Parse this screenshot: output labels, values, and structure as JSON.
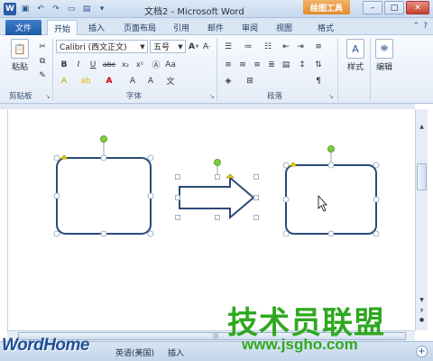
{
  "titlebar": {
    "title": "文档2 - Microsoft Word",
    "context_tab": "绘图工具",
    "app_icon": "W",
    "quick_access": [
      "save-icon",
      "undo-icon",
      "redo-icon",
      "new-icon",
      "open-icon",
      "customize-icon"
    ]
  },
  "tabs": [
    {
      "label": "文件"
    },
    {
      "label": "开始"
    },
    {
      "label": "插入"
    },
    {
      "label": "页面布局"
    },
    {
      "label": "引用"
    },
    {
      "label": "邮件"
    },
    {
      "label": "审阅"
    },
    {
      "label": "视图"
    },
    {
      "label": "格式"
    }
  ],
  "ribbon": {
    "clipboard": {
      "paste_label": "粘贴",
      "group_label": "剪贴板"
    },
    "font": {
      "font_name": "Calibri (西文正文)",
      "font_size": "五号",
      "group_label": "字体"
    },
    "paragraph": {
      "group_label": "段落"
    },
    "styles": {
      "label": "样式"
    },
    "editing": {
      "label": "编辑"
    }
  },
  "statusbar": {
    "language": "英语(美国)",
    "mode": "插入",
    "zoom_plus": "+"
  },
  "watermark": {
    "left_logo": "WordHome",
    "brand_cn": "技术员联盟",
    "url": "www.jsgho.com"
  },
  "colors": {
    "shape_stroke": "#2c4a78",
    "handle_green": "#7ccf3a",
    "context_tab": "#e8943a",
    "watermark_green": "#2fa820"
  }
}
